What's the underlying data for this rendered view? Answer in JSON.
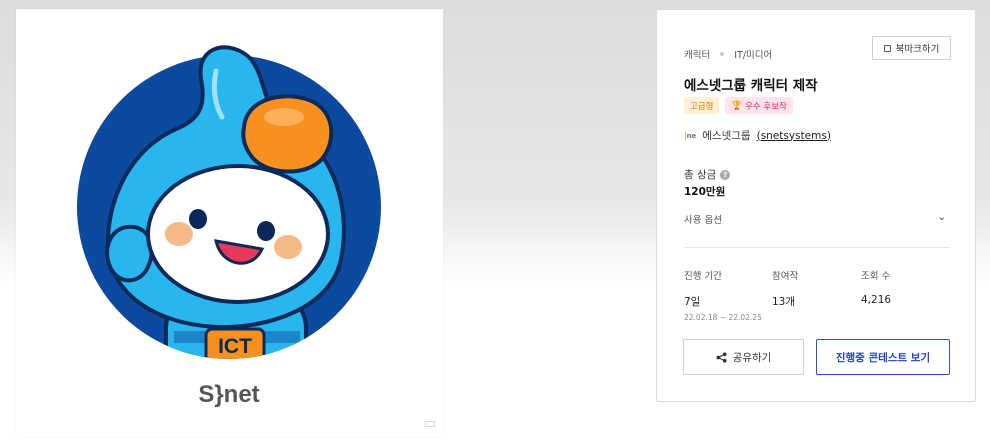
{
  "card": {
    "categories": [
      "캐릭터",
      "IT/미디어"
    ],
    "bookmark_label": "북마크하기",
    "title": "에스넷그룹 캐릭터 제작",
    "badges": [
      {
        "label": "고급형",
        "tone": "warning"
      },
      {
        "label": "우수 후보작",
        "tone": "pink",
        "icon": "trophy-icon"
      }
    ],
    "host": {
      "logo_text": "ne",
      "name": "에스넷그룹",
      "handle": "(snetsystems)"
    },
    "prize": {
      "label": "총 상금",
      "value": "120만원"
    },
    "usage_label": "사용 옵션",
    "stats": {
      "period": {
        "label": "진행 기간",
        "value": "7일",
        "range": "22.02.18 ~ 22.02.25"
      },
      "entries": {
        "label": "참여작",
        "value": "13개"
      },
      "views": {
        "label": "조회 수",
        "value": "4,216"
      }
    },
    "share_label": "공유하기",
    "view_contests_label": "진행중 콘테스트 보기"
  },
  "image": {
    "badge_text": "ICT",
    "brand_text": "S}net"
  },
  "colors": {
    "accent": "#2340c9",
    "circle_bg": "#0b4a9e",
    "mascot_body": "#29b6ee",
    "mascot_orange": "#f7901e",
    "warning_badge_bg": "#fff1d6",
    "pink_badge_bg": "#ffe4ec"
  }
}
